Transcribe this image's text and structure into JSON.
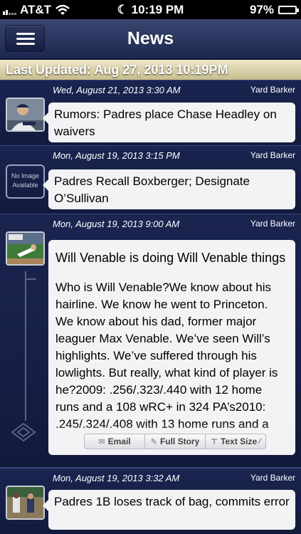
{
  "status": {
    "carrier": "AT&T",
    "time": "10:19 PM",
    "battery": "97%",
    "battery_level": 0.97
  },
  "nav": {
    "title": "News"
  },
  "updated": "Last Updated: Aug 27, 2013 10:19PM",
  "articles": [
    {
      "date": "Wed, August 21, 2013 3:30 AM",
      "source": "Yard Barker",
      "title": "Rumors: Padres place Chase Headley on waivers"
    },
    {
      "date": "Mon, August 19, 2013 3:15 PM",
      "source": "Yard Barker",
      "no_image": "No Image Available",
      "title": "Padres Recall Boxberger; Designate O’Sullivan"
    },
    {
      "date": "Mon, August 19, 2013 9:00 AM",
      "source": "Yard Barker",
      "title": "Will Venable is doing Will Venable things",
      "body": "Who is Will Venable?We know about his hairline. We know he went to Princeton. We know about his dad, former major leaguer Max Venable. We’ve seen Will’s highlights. We’ve suffered through his lowlights. But really, what kind of player is he?2009: .256/.323/.440 with 12 home runs and a 108 wRC+ in 324 PA’s2010: .245/.324/.408 with 13 home runs and a"
    },
    {
      "date": "Mon, August 19, 2013 3:32 AM",
      "source": "Yard Barker",
      "title": "Padres 1B loses track of bag, commits error"
    }
  ],
  "actions": {
    "email": "Email",
    "full_story": "Full Story",
    "text_size": "Text Size"
  },
  "icons": {
    "menu": "hamburger-menu-icon",
    "email": "envelope-icon",
    "full_story": "pencil-icon",
    "text_size": "text-size-icon"
  }
}
